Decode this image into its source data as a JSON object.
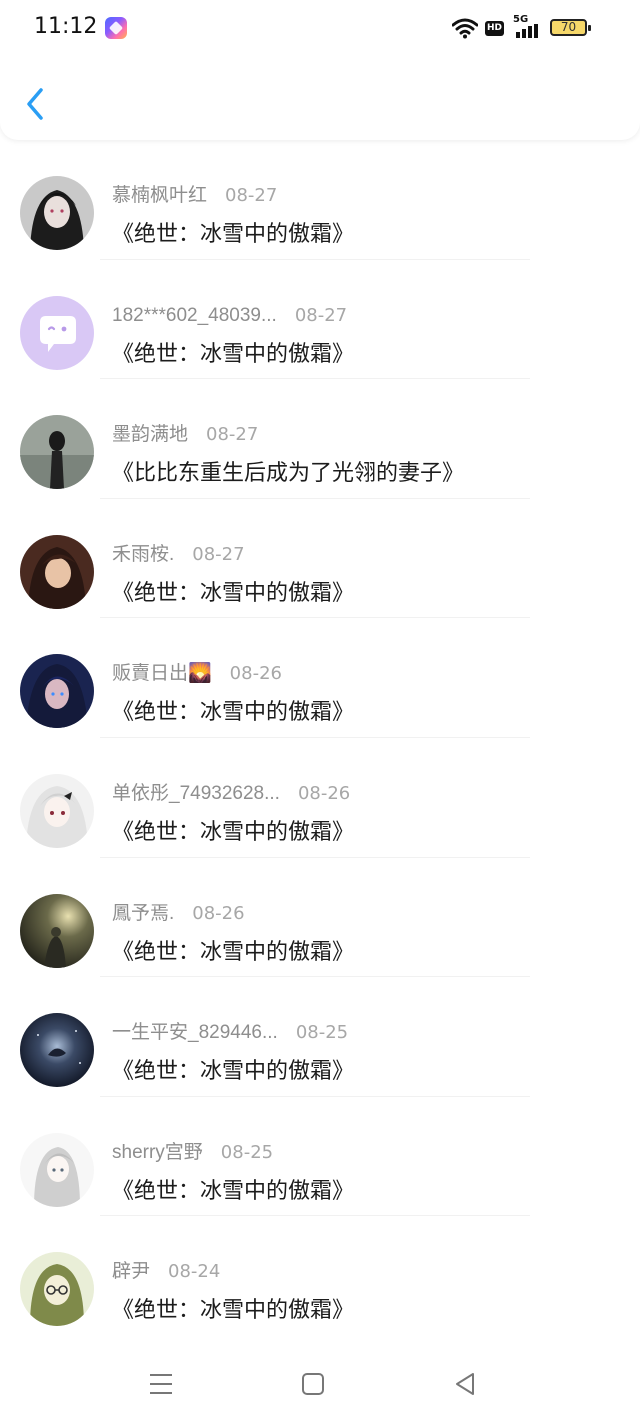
{
  "status_bar": {
    "time": "11:12",
    "network_type": "5G",
    "hd_label": "HD",
    "battery": "70",
    "icons": [
      "app-icon",
      "wifi-icon",
      "hd-icon",
      "signal-icon",
      "battery-icon"
    ]
  },
  "nav": {
    "back_icon": "chevron-left-icon",
    "accent_color": "#2a9ef4"
  },
  "list": [
    {
      "user": "慕楠枫叶红",
      "date": "08-27",
      "book": "《绝世：冰雪中的傲霜》"
    },
    {
      "user": "182***602_48039...",
      "date": "08-27",
      "book": "《绝世：冰雪中的傲霜》"
    },
    {
      "user": "墨韵满地",
      "date": "08-27",
      "book": "《比比东重生后成为了光翎的妻子》"
    },
    {
      "user": "禾雨桉.",
      "date": "08-27",
      "book": "《绝世：冰雪中的傲霜》"
    },
    {
      "user": "贩賣日出🌄",
      "date": "08-26",
      "book": "《绝世：冰雪中的傲霜》"
    },
    {
      "user": "单依彤_74932628...",
      "date": "08-26",
      "book": "《绝世：冰雪中的傲霜》"
    },
    {
      "user": "鳳予焉.",
      "date": "08-26",
      "book": "《绝世：冰雪中的傲霜》"
    },
    {
      "user": "一生平安_829446...",
      "date": "08-25",
      "book": "《绝世：冰雪中的傲霜》"
    },
    {
      "user": "sherry宫野",
      "date": "08-25",
      "book": "《绝世：冰雪中的傲霜》"
    },
    {
      "user": "辟尹",
      "date": "08-24",
      "book": "《绝世：冰雪中的傲霜》"
    }
  ],
  "bottom_nav": {
    "icons": [
      "menu-icon",
      "home-icon",
      "back-triangle-icon"
    ]
  }
}
